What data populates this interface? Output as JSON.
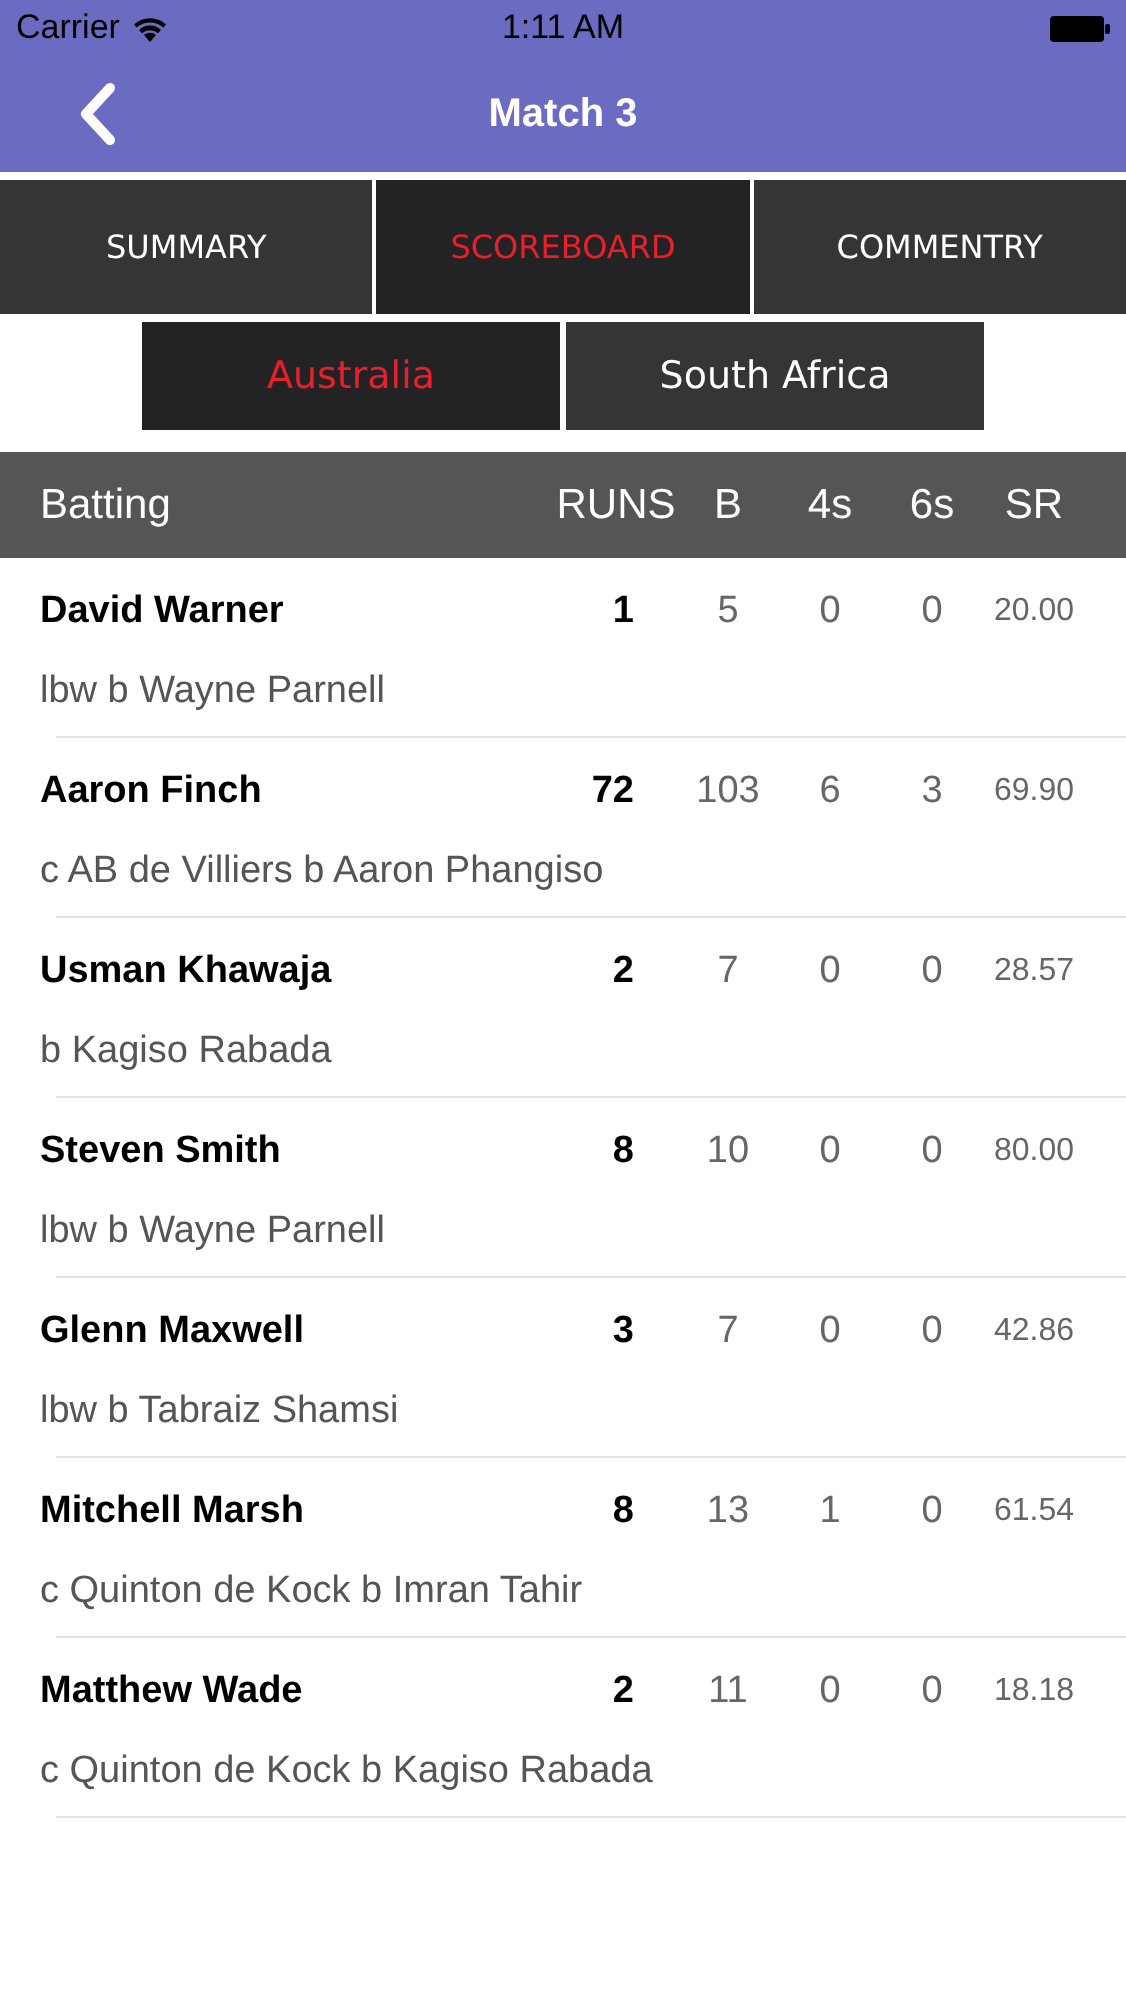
{
  "status_bar": {
    "carrier": "Carrier",
    "time": "1:11 AM"
  },
  "nav": {
    "title": "Match 3"
  },
  "tabs": [
    {
      "label": "SUMMARY",
      "selected": false
    },
    {
      "label": "SCOREBOARD",
      "selected": true
    },
    {
      "label": "COMMENTRY",
      "selected": false
    }
  ],
  "teams": [
    {
      "label": "Australia",
      "selected": true
    },
    {
      "label": "South Africa",
      "selected": false
    }
  ],
  "table": {
    "columns": [
      "Batting",
      "RUNS",
      "B",
      "4s",
      "6s",
      "SR"
    ],
    "rows": [
      {
        "name": "David Warner",
        "dismissal": "lbw b Wayne Parnell",
        "runs": "1",
        "balls": "5",
        "fours": "0",
        "sixes": "0",
        "sr": "20.00"
      },
      {
        "name": "Aaron Finch",
        "dismissal": "c AB de Villiers b Aaron Phangiso",
        "runs": "72",
        "balls": "103",
        "fours": "6",
        "sixes": "3",
        "sr": "69.90"
      },
      {
        "name": "Usman Khawaja",
        "dismissal": "b Kagiso Rabada",
        "runs": "2",
        "balls": "7",
        "fours": "0",
        "sixes": "0",
        "sr": "28.57"
      },
      {
        "name": "Steven Smith",
        "dismissal": "lbw b Wayne Parnell",
        "runs": "8",
        "balls": "10",
        "fours": "0",
        "sixes": "0",
        "sr": "80.00"
      },
      {
        "name": "Glenn Maxwell",
        "dismissal": "lbw b Tabraiz Shamsi",
        "runs": "3",
        "balls": "7",
        "fours": "0",
        "sixes": "0",
        "sr": "42.86"
      },
      {
        "name": "Mitchell Marsh",
        "dismissal": "c Quinton de Kock b Imran Tahir",
        "runs": "8",
        "balls": "13",
        "fours": "1",
        "sixes": "0",
        "sr": "61.54"
      },
      {
        "name": "Matthew Wade",
        "dismissal": "c Quinton de Kock b Kagiso Rabada",
        "runs": "2",
        "balls": "11",
        "fours": "0",
        "sixes": "0",
        "sr": "18.18"
      }
    ]
  }
}
